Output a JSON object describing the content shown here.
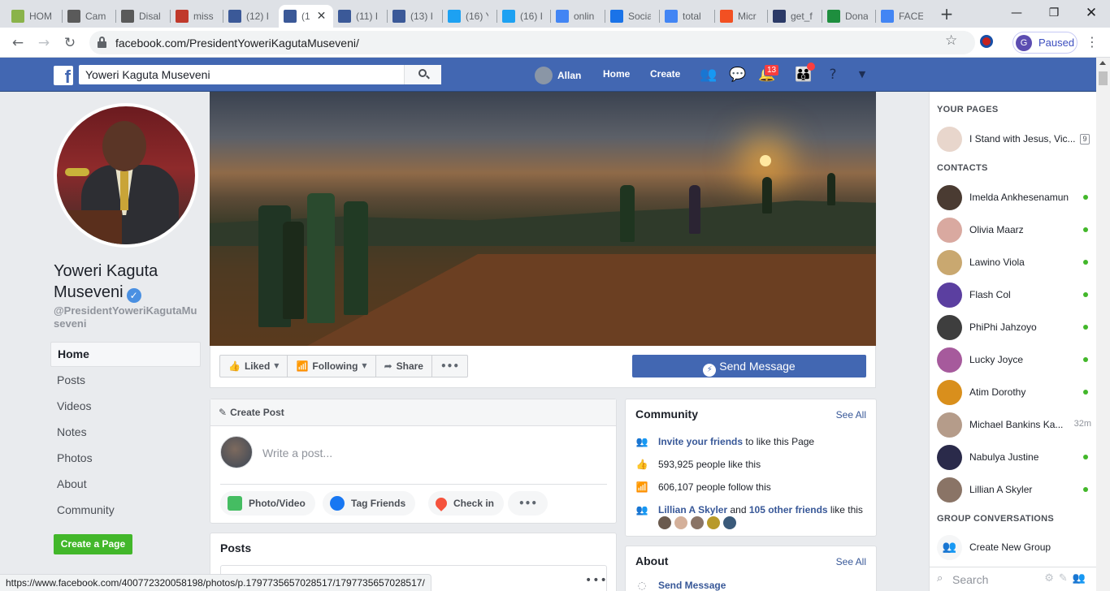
{
  "browser": {
    "tabs": [
      {
        "label": "HOM",
        "favicon": "plant-icon",
        "color": "#8ab34a"
      },
      {
        "label": "Cam",
        "favicon": "campaign-icon",
        "color": "#5a5a5a"
      },
      {
        "label": "Disal",
        "favicon": "campaign-icon",
        "color": "#5a5a5a"
      },
      {
        "label": "miss",
        "favicon": "people-icon",
        "color": "#c0392b"
      },
      {
        "label": "(12) I",
        "favicon": "facebook-icon",
        "color": "#3b5998"
      },
      {
        "label": "(1",
        "favicon": "facebook-icon",
        "color": "#3b5998",
        "active": true
      },
      {
        "label": "(11) I",
        "favicon": "facebook-icon",
        "color": "#3b5998"
      },
      {
        "label": "(13) I",
        "favicon": "facebook-icon",
        "color": "#3b5998"
      },
      {
        "label": "(16) Y",
        "favicon": "twitter-icon",
        "color": "#1da1f2"
      },
      {
        "label": "(16) I",
        "favicon": "twitter-icon",
        "color": "#1da1f2"
      },
      {
        "label": "onlin",
        "favicon": "google-icon",
        "color": "#4285f4"
      },
      {
        "label": "Socia",
        "favicon": "social-icon",
        "color": "#1a73e8"
      },
      {
        "label": "total",
        "favicon": "google-icon",
        "color": "#4285f4"
      },
      {
        "label": "Micr",
        "favicon": "microsoft-icon",
        "color": "#f25022"
      },
      {
        "label": "get_f",
        "favicon": "document-icon",
        "color": "#2b3a67"
      },
      {
        "label": "Dona",
        "favicon": "sheet-icon",
        "color": "#1e8e3e"
      },
      {
        "label": "FACE",
        "favicon": "google-icon",
        "color": "#4285f4"
      }
    ],
    "url": "facebook.com/PresidentYoweriKagutaMuseveni/",
    "profile_initial": "G",
    "profile_label": "Paused",
    "status_url": "https://www.facebook.com/400772320058198/photos/p.1797735657028517/1797735657028517/"
  },
  "fb": {
    "search_value": "Yoweri Kaguta Museveni",
    "user_name": "Allan",
    "nav_home": "Home",
    "nav_create": "Create",
    "notif_count": "13",
    "brand_color": "#4267b2"
  },
  "page": {
    "name": "Yoweri Kaguta Museveni",
    "handle": "@PresidentYoweriKagutaMuseveni",
    "nav": [
      "Home",
      "Posts",
      "Videos",
      "Notes",
      "Photos",
      "About",
      "Community"
    ],
    "create_page": "Create a Page",
    "actions": {
      "liked": "Liked",
      "following": "Following",
      "share": "Share",
      "send_message": "Send Message"
    }
  },
  "create_post": {
    "title": "Create Post",
    "placeholder": "Write a post...",
    "photo_video": "Photo/Video",
    "tag_friends": "Tag Friends",
    "check_in": "Check in"
  },
  "posts": {
    "title": "Posts"
  },
  "community": {
    "title": "Community",
    "see_all": "See All",
    "invite_link": "Invite your friends",
    "invite_rest": "to like this Page",
    "likes": "593,925 people like this",
    "follows": "606,107 people follow this",
    "friend_name": "Lillian A Skyler",
    "friends_and": "and",
    "friends_other": "105 other friends",
    "friends_rest": "like this"
  },
  "about": {
    "title": "About",
    "see_all": "See All",
    "send_message": "Send Message"
  },
  "sidebar": {
    "your_pages": "YOUR PAGES",
    "page_item": "I Stand with Jesus, Vic...",
    "page_count": "9",
    "contacts_heading": "CONTACTS",
    "contacts": [
      {
        "name": "Imelda Ankhesenamun",
        "online": true,
        "color": "#4a3b32"
      },
      {
        "name": "Olivia Maarz",
        "online": true,
        "color": "#d9a9a0"
      },
      {
        "name": "Lawino Viola",
        "online": true,
        "color": "#c9a870"
      },
      {
        "name": "Flash Col",
        "online": true,
        "color": "#5b3fa0"
      },
      {
        "name": "PhiPhi Jahzoyo",
        "online": true,
        "color": "#3e3e3e"
      },
      {
        "name": "Lucky Joyce",
        "online": true,
        "color": "#a65a9c"
      },
      {
        "name": "Atim Dorothy",
        "online": true,
        "color": "#d98f1c"
      },
      {
        "name": "Michael Bankins Ka...",
        "online": false,
        "time": "32m",
        "color": "#b59c8a"
      },
      {
        "name": "Nabulya Justine",
        "online": true,
        "color": "#2a2a4a"
      },
      {
        "name": "Lillian A Skyler",
        "online": true,
        "color": "#8a7466"
      }
    ],
    "group_heading": "GROUP CONVERSATIONS",
    "create_group": "Create New Group",
    "search_placeholder": "Search"
  }
}
